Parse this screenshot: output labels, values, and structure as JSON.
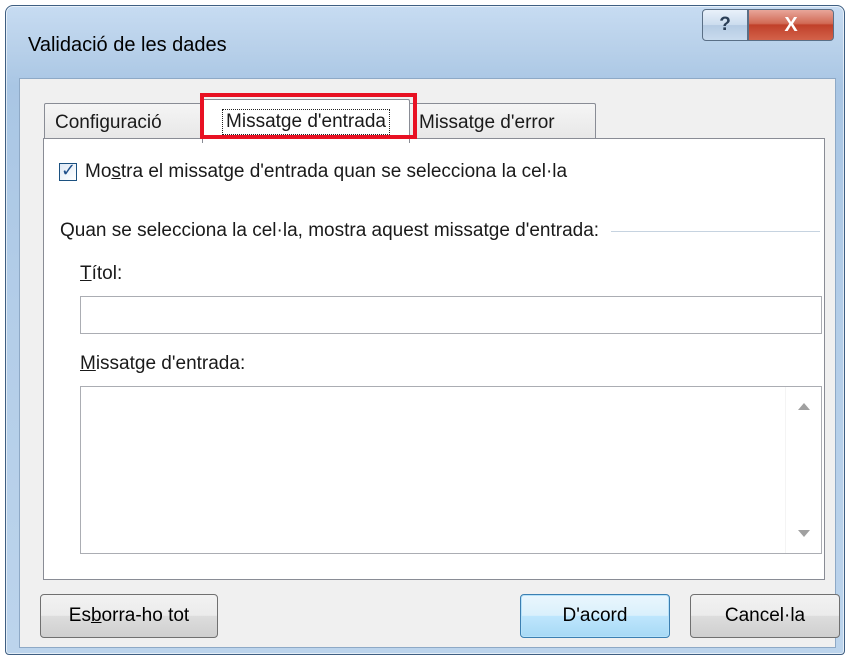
{
  "window": {
    "title": "Validació de les dades",
    "help_label": "?",
    "close_label": "X"
  },
  "tabs": [
    {
      "label": "Configuració",
      "active": false
    },
    {
      "label": "Missatge d'entrada",
      "active": true
    },
    {
      "label": "Missatge d'error",
      "active": false
    }
  ],
  "panel": {
    "show_checkbox": {
      "checked": true,
      "label_pre": "Mo",
      "label_mnemonic": "s",
      "label_post": "tra el missatge d'entrada quan se selecciona la cel·la"
    },
    "section_header": "Quan se selecciona la cel·la, mostra aquest missatge d'entrada:",
    "title_field": {
      "label_mnemonic": "T",
      "label_rest": "ítol:",
      "value": ""
    },
    "message_field": {
      "label_mnemonic": "M",
      "label_rest": "issatge d'entrada:",
      "value": ""
    }
  },
  "buttons": {
    "clear_all": {
      "pre": "Es",
      "mnemonic": "b",
      "post": "orra-ho tot"
    },
    "ok": "D'acord",
    "cancel": "Cancel·la"
  },
  "colors": {
    "highlight": "#e81123",
    "titlebar": "#b9d1ea",
    "close_button": "#c0402a"
  }
}
